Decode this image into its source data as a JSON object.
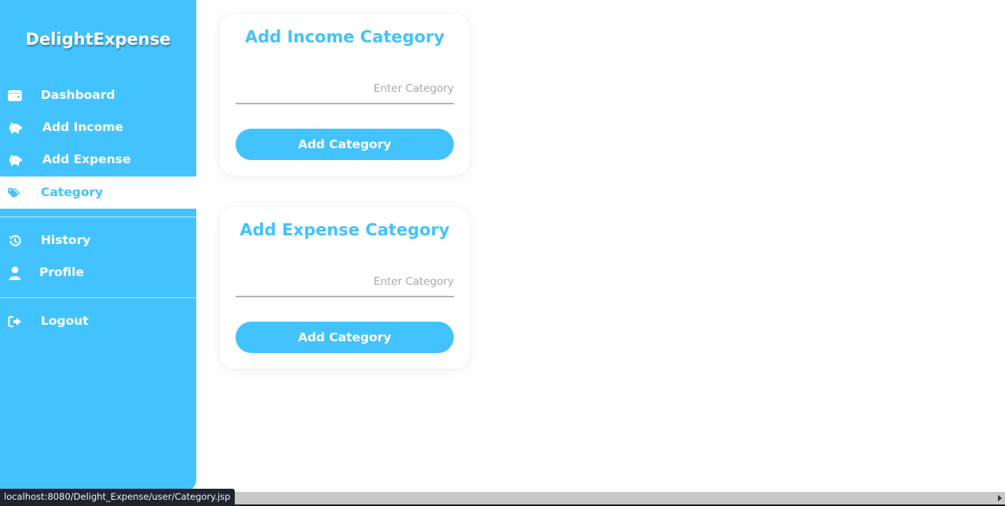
{
  "app": {
    "brand": "DelightExpense"
  },
  "sidebar": {
    "items": [
      {
        "label": "Dashboard",
        "icon": "wallet-icon"
      },
      {
        "label": "Add Income",
        "icon": "piggy-bank-icon"
      },
      {
        "label": "Add Expense",
        "icon": "piggy-bank-icon"
      },
      {
        "label": "Category",
        "icon": "tags-icon",
        "active": true
      },
      {
        "label": "History",
        "icon": "history-icon"
      },
      {
        "label": "Profile",
        "icon": "user-icon"
      },
      {
        "label": "Logout",
        "icon": "sign-out-icon"
      }
    ]
  },
  "income_card": {
    "title": "Add Income Category",
    "input_placeholder": "Enter Category",
    "input_value": "",
    "button_label": "Add Category"
  },
  "expense_card": {
    "title": "Add Expense Category",
    "input_placeholder": "Enter Category",
    "input_value": "",
    "button_label": "Add Category"
  },
  "status_bar": {
    "url": "localhost:8080/Delight_Expense/user/Category.jsp"
  },
  "colors": {
    "accent": "#43c3fe",
    "sidebar_text": "#ffffff",
    "active_bg": "#ffffff"
  }
}
